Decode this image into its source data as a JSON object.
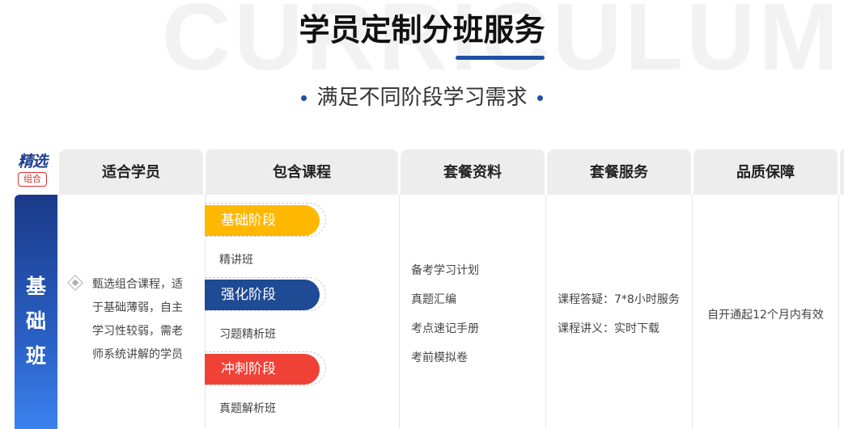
{
  "header": {
    "watermark": "CURRICULUM",
    "title": "学员定制分班服务",
    "subtitle": "满足不同阶段学习需求"
  },
  "logo": {
    "top": "精选",
    "box": "组合"
  },
  "table": {
    "columns": [
      "适合学员",
      "包含课程",
      "套餐资料",
      "套餐服务",
      "品质保障"
    ],
    "row_label_chars": [
      "基",
      "础",
      "班"
    ],
    "student_lines": [
      "甄选组合课程，适",
      "于基础薄弱，自主",
      "学习性较弱，需老",
      "师系统讲解的学员"
    ],
    "stages": [
      {
        "name": "基础阶段",
        "course": "精讲班",
        "color": "#ffb800"
      },
      {
        "name": "强化阶段",
        "course": "习题精析班",
        "color": "#1f4a94"
      },
      {
        "name": "冲刺阶段",
        "course": "真题解析班",
        "color": "#f04136"
      }
    ],
    "materials": [
      "备考学习计划",
      "真题汇编",
      "考点速记手册",
      "考前模拟卷"
    ],
    "services": [
      "课程答疑：7*8小时服务",
      "课程讲义：实时下载"
    ],
    "quality": "自开通起12个月内有效"
  }
}
